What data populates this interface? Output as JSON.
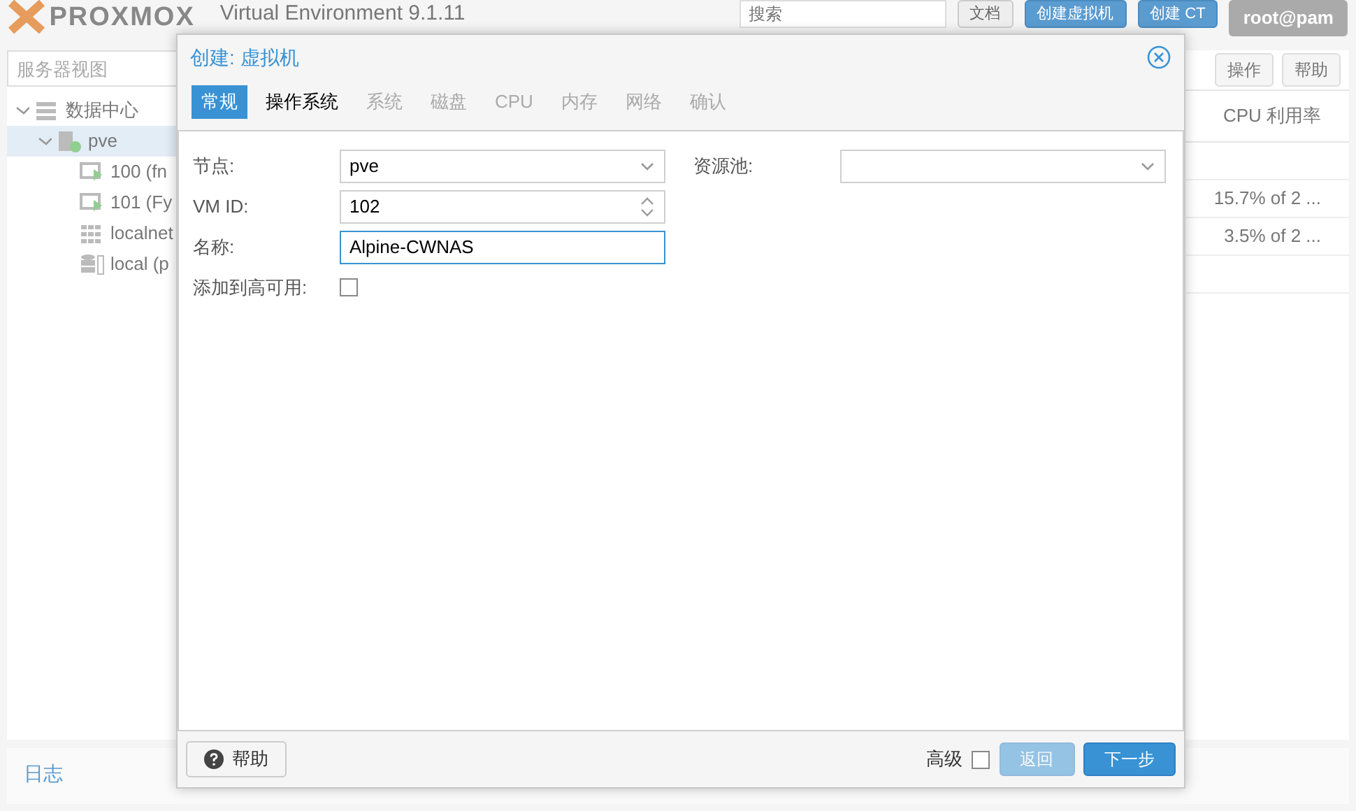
{
  "header": {
    "logo": "PROXMOX",
    "version": "Virtual Environment 9.1.11",
    "search": {
      "placeholder": "搜索"
    },
    "buttons": [
      "文档",
      "创建虚拟机",
      "创建 CT"
    ],
    "user": "root@pam"
  },
  "sidebar": {
    "view": "服务器视图",
    "tree": [
      {
        "label": "数据中心",
        "kind": "datacenter",
        "expanded": true,
        "selected": false,
        "children": [
          {
            "label": "pve",
            "kind": "node",
            "expanded": true,
            "selected": true,
            "children": [
              {
                "label": "100 (fn",
                "kind": "vm",
                "selected": false
              },
              {
                "label": "101 (Fy",
                "kind": "vm",
                "selected": false
              },
              {
                "label": "localnet",
                "kind": "network",
                "selected": false
              },
              {
                "label": "local (p",
                "kind": "storage",
                "selected": false
              }
            ]
          }
        ]
      }
    ]
  },
  "content": {
    "toolbar": [
      "操作",
      "帮助"
    ],
    "column": "CPU 利用率",
    "rows": [
      "",
      "15.7% of 2 ...",
      "3.5% of 2 ...",
      ""
    ]
  },
  "log": {
    "title": "日志"
  },
  "dialog": {
    "title": "创建: 虚拟机",
    "tabs": [
      {
        "label": "常规",
        "selected": true,
        "disabled": false
      },
      {
        "label": "操作系统",
        "selected": false,
        "disabled": false
      },
      {
        "label": "系统",
        "selected": false,
        "disabled": true
      },
      {
        "label": "磁盘",
        "selected": false,
        "disabled": true
      },
      {
        "label": "CPU",
        "selected": false,
        "disabled": true
      },
      {
        "label": "内存",
        "selected": false,
        "disabled": true
      },
      {
        "label": "网络",
        "selected": false,
        "disabled": true
      },
      {
        "label": "确认",
        "selected": false,
        "disabled": true
      }
    ],
    "left_fields": [
      {
        "kind": "select",
        "label": "节点:",
        "value": "pve"
      },
      {
        "kind": "spinner",
        "label": "VM ID:",
        "value": "102"
      },
      {
        "kind": "text",
        "label": "名称:",
        "value": "Alpine-CWNAS",
        "focused": true
      },
      {
        "kind": "checkbox",
        "label": "添加到高可用:",
        "checked": false
      }
    ],
    "right_fields": [
      {
        "kind": "select",
        "label": "资源池:"
      }
    ],
    "footer": {
      "help": "帮助",
      "advanced": {
        "label": "高级",
        "checked": false
      },
      "back": {
        "label": "返回",
        "disabled": true
      },
      "next": "下一步"
    }
  }
}
